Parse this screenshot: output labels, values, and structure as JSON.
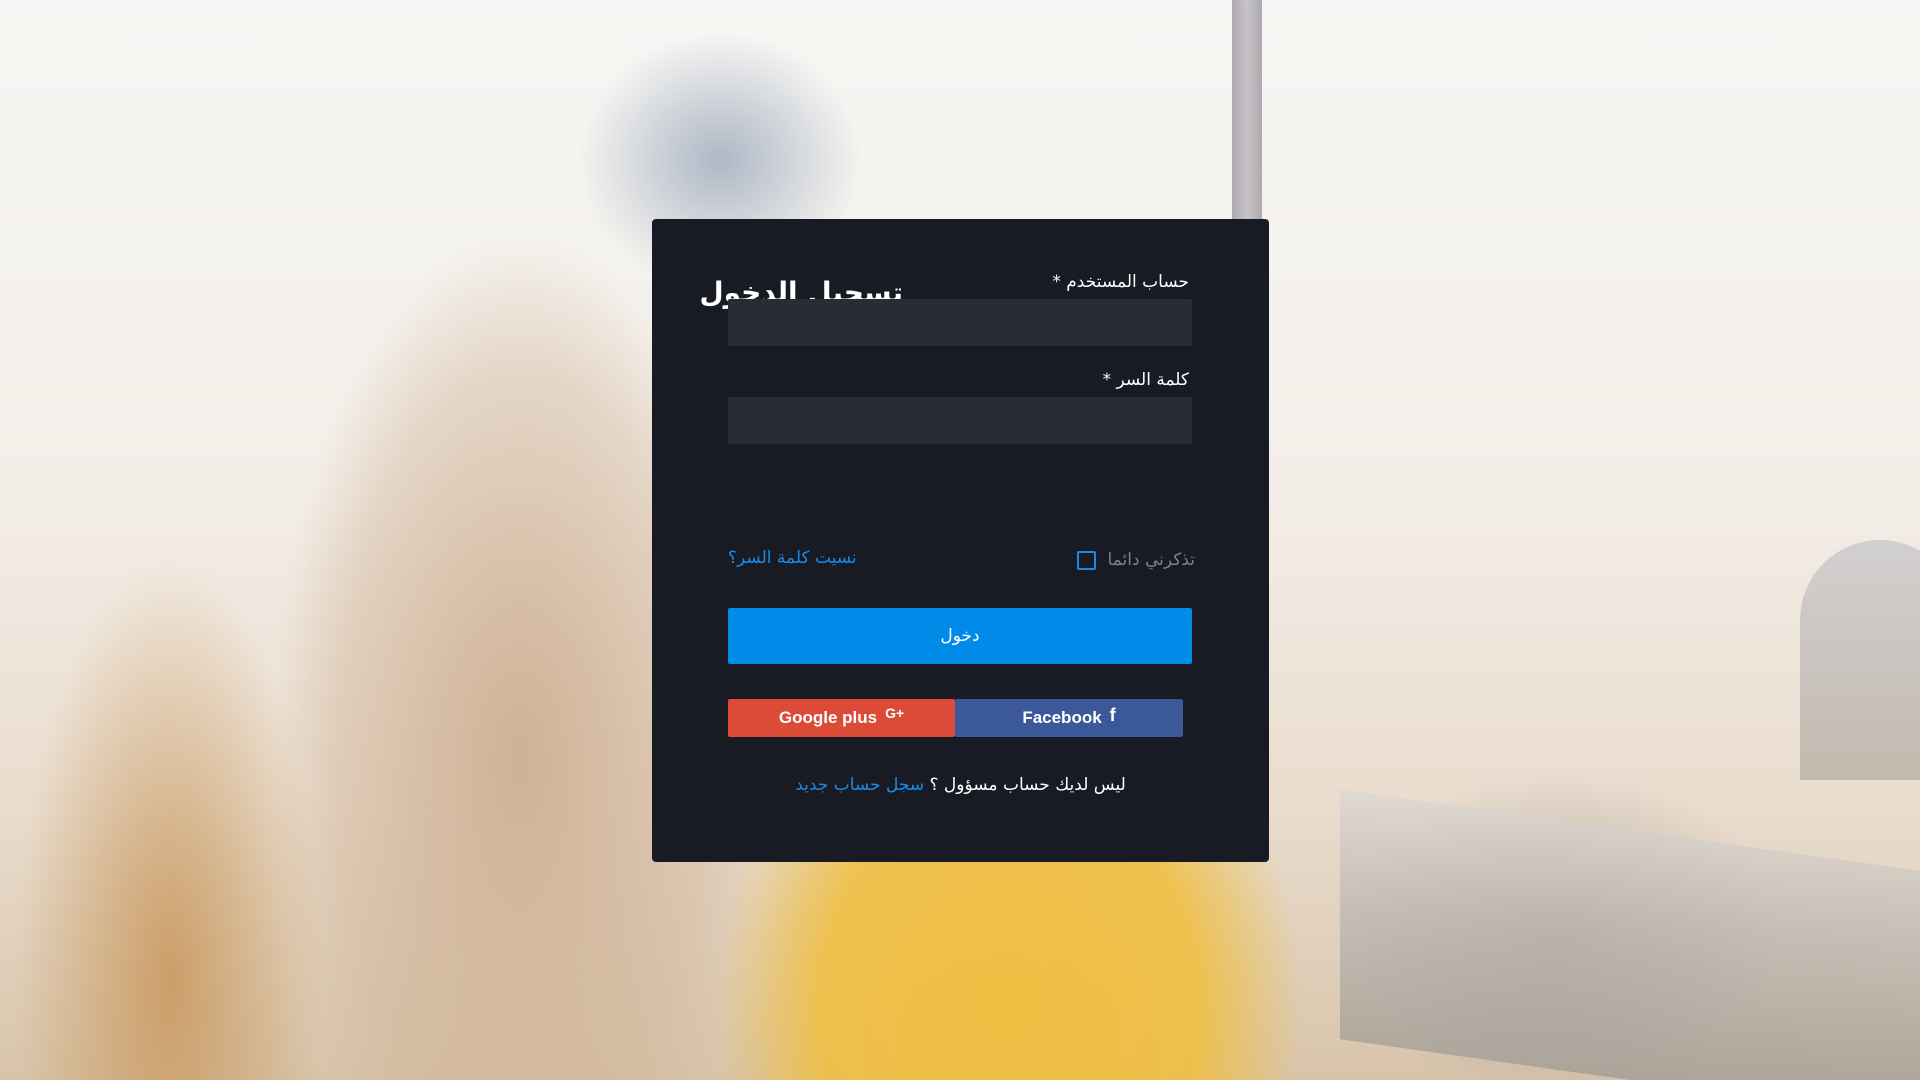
{
  "login": {
    "title": "تسجيل الدخول",
    "username_label": "حساب المستخدم",
    "username_value": "",
    "password_label": "كلمة السر",
    "password_value": "",
    "required_mark": "*",
    "remember_label": "تذكرني دائما",
    "remember_checked": false,
    "forgot_label": "نسيت كلمة السر؟",
    "submit_label": "دخول",
    "google_label": "Google plus",
    "google_icon": "G+",
    "facebook_label": "Facebook",
    "facebook_icon": "f",
    "no_account_text": "ليس لديك حساب مسؤول ؟",
    "register_label": "سجل حساب جديد"
  },
  "colors": {
    "card_bg": "#191b24",
    "input_bg": "#282d34",
    "accent": "#008be8",
    "link": "#1b8ae6",
    "google": "#db4b38",
    "facebook": "#3b5998",
    "muted_text": "#7b8190"
  }
}
